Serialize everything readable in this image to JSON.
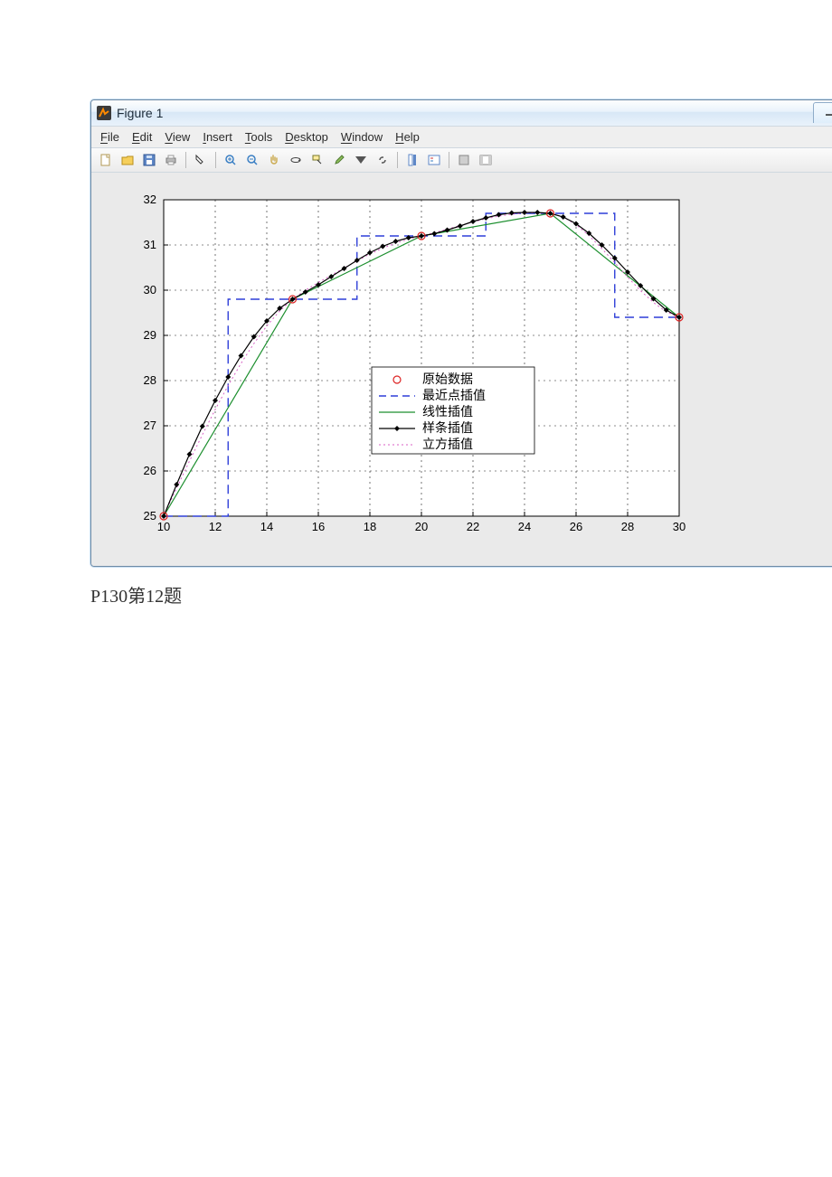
{
  "window": {
    "title": "Figure 1"
  },
  "menu": {
    "file": "File",
    "edit": "Edit",
    "view": "View",
    "insert": "Insert",
    "tools": "Tools",
    "desktop": "Desktop",
    "window": "Window",
    "help": "Help"
  },
  "toolbar_icons": {
    "new": "new-file-icon",
    "open": "open-folder-icon",
    "save": "save-icon",
    "print": "print-icon",
    "pointer": "pointer-icon",
    "zoomin": "zoom-in-icon",
    "zoomout": "zoom-out-icon",
    "pan": "pan-hand-icon",
    "rotate": "rotate-3d-icon",
    "datacursor": "data-cursor-icon",
    "brush": "brush-icon",
    "link": "link-plots-icon",
    "colorbar": "colorbar-icon",
    "legend": "legend-icon",
    "hideplot": "hide-plot-tools-icon",
    "showplot": "show-plot-tools-icon"
  },
  "caption": "P130第12题",
  "chart_data": {
    "type": "line",
    "xlim": [
      10,
      30
    ],
    "ylim": [
      25,
      32
    ],
    "xticks": [
      10,
      12,
      14,
      16,
      18,
      20,
      22,
      24,
      26,
      28,
      30
    ],
    "yticks": [
      25,
      26,
      27,
      28,
      29,
      30,
      31,
      32
    ],
    "original_x": [
      10,
      15,
      20,
      25,
      30
    ],
    "original_y": [
      25,
      29.8,
      31.2,
      31.7,
      29.4
    ],
    "nearest_x": [
      10,
      12.5,
      12.5,
      17.5,
      17.5,
      22.5,
      22.5,
      27.5,
      27.5,
      30
    ],
    "nearest_y": [
      25,
      25,
      29.8,
      29.8,
      31.2,
      31.2,
      31.7,
      31.7,
      29.4,
      29.4
    ],
    "linear_x": [
      10,
      15,
      20,
      25,
      30
    ],
    "linear_y": [
      25,
      29.8,
      31.2,
      31.7,
      29.4
    ],
    "spline_x": [
      10,
      10.5,
      11,
      11.5,
      12,
      12.5,
      13,
      13.5,
      14,
      14.5,
      15,
      15.5,
      16,
      16.5,
      17,
      17.5,
      18,
      18.5,
      19,
      19.5,
      20,
      20.5,
      21,
      21.5,
      22,
      22.5,
      23,
      23.5,
      24,
      24.5,
      25,
      25.5,
      26,
      26.5,
      27,
      27.5,
      28,
      28.5,
      29,
      29.5,
      30
    ],
    "spline_y": [
      25,
      25.7,
      26.37,
      26.99,
      27.56,
      28.08,
      28.55,
      28.97,
      29.32,
      29.6,
      29.8,
      29.96,
      30.12,
      30.3,
      30.48,
      30.66,
      30.83,
      30.97,
      31.08,
      31.16,
      31.2,
      31.25,
      31.33,
      31.42,
      31.52,
      31.6,
      31.67,
      31.71,
      31.72,
      31.72,
      31.7,
      31.62,
      31.47,
      31.26,
      31.0,
      30.71,
      30.4,
      30.1,
      29.81,
      29.56,
      29.4
    ],
    "cubic_x": [
      10,
      10.5,
      11,
      11.5,
      12,
      12.5,
      13,
      13.5,
      14,
      14.5,
      15,
      15.5,
      16,
      16.5,
      17,
      17.5,
      18,
      18.5,
      19,
      19.5,
      20,
      20.5,
      21,
      21.5,
      22,
      22.5,
      23,
      23.5,
      24,
      24.5,
      25,
      25.5,
      26,
      26.5,
      27,
      27.5,
      28,
      28.5,
      29,
      29.5,
      30
    ],
    "cubic_y": [
      25,
      25.62,
      26.22,
      26.8,
      27.36,
      27.89,
      28.38,
      28.82,
      29.21,
      29.54,
      29.8,
      30.0,
      30.17,
      30.33,
      30.49,
      30.65,
      30.8,
      30.93,
      31.04,
      31.13,
      31.2,
      31.27,
      31.35,
      31.43,
      31.51,
      31.58,
      31.64,
      31.68,
      31.71,
      31.71,
      31.7,
      31.62,
      31.45,
      31.21,
      30.92,
      30.61,
      30.29,
      29.99,
      29.73,
      29.52,
      29.4
    ],
    "legend": {
      "items": [
        {
          "label": "原始数据",
          "style": "marker-circle-red"
        },
        {
          "label": "最近点插值",
          "style": "dashed-blue"
        },
        {
          "label": "线性插值",
          "style": "solid-green"
        },
        {
          "label": "样条插值",
          "style": "black-diamond-line"
        },
        {
          "label": "立方插值",
          "style": "dotted-magenta"
        }
      ],
      "position": "center"
    }
  }
}
